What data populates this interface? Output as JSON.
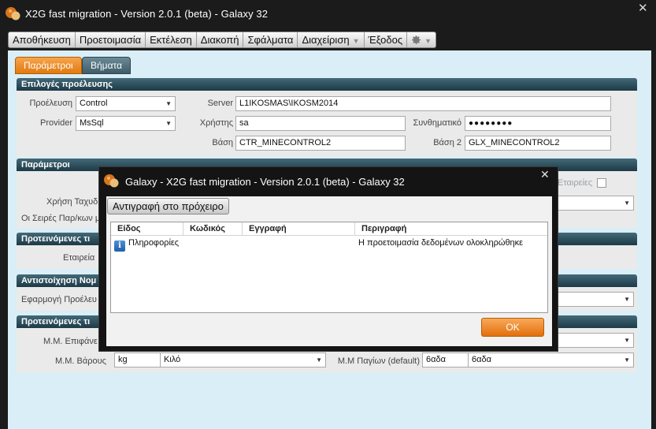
{
  "window": {
    "title": "X2G fast migration - Version 2.0.1 (beta) - Galaxy 32",
    "close_glyph": "✕"
  },
  "menu": [
    {
      "label": "Αποθήκευση",
      "has_dropdown": false
    },
    {
      "label": "Προετοιμασία",
      "has_dropdown": false
    },
    {
      "label": "Εκτέλεση",
      "has_dropdown": false
    },
    {
      "label": "Διακοπή",
      "has_dropdown": false
    },
    {
      "label": "Σφάλματα",
      "has_dropdown": false
    },
    {
      "label": "Διαχείριση",
      "has_dropdown": true
    },
    {
      "label": "Έξοδος",
      "has_dropdown": false
    },
    {
      "label": "",
      "icon": "gear-icon",
      "has_dropdown": true
    }
  ],
  "tabs": {
    "params": "Παράμετροι",
    "steps": "Βήματα",
    "active": "params"
  },
  "source": {
    "header": "Επιλογές προέλευσης",
    "source_label": "Προέλευση",
    "source_value": "Control",
    "provider_label": "Provider",
    "provider_value": "MsSql",
    "server_label": "Server",
    "server_value": "L1IKOSMAS\\IKOSM2014",
    "user_label": "Χρήστης",
    "user_value": "sa",
    "password_label": "Συνθηματικό",
    "password_value": "●●●●●●●●",
    "db_label": "Βάση",
    "db_value": "CTR_MINECONTROL2",
    "db2_label": "Βάση 2",
    "db2_value": "GLX_MINECONTROL2"
  },
  "params": {
    "header": "Παράμετροι",
    "cash_user_label": "Χρήση Ταχυδ",
    "series_label": "Οι Σειρές Παρ/κων μ",
    "companies_label": "Εταιρείες"
  },
  "suggested1": {
    "header": "Προτεινόμενες τι",
    "company_label": "Εταιρεία"
  },
  "mapping": {
    "header": "Αντιστοίχηση Νομ",
    "apply_label": "Εφαρμογή Προέλευ"
  },
  "suggested2": {
    "header": "Προτεινόμενες τι",
    "surface_label": "Μ.Μ. Επιφάνε",
    "weight_label": "Μ.Μ. Βάρους",
    "weight_code": "kg",
    "weight_value": "Κιλό",
    "fixed_label": "Μ.Μ Παγίων (default)",
    "fixed_code": "6αδα",
    "fixed_value": "6αδα"
  },
  "dialog": {
    "title": "Galaxy - X2G fast migration - Version 2.0.1 (beta) - Galaxy 32",
    "close_glyph": "✕",
    "copy_button": "Αντιγραφή στο πρόχειρο",
    "columns": [
      "Είδος",
      "Κωδικός",
      "Εγγραφή",
      "Περιγραφή"
    ],
    "rows": [
      {
        "type": "Πληροφορίες",
        "type_icon": "info-icon",
        "code": "",
        "record": "",
        "description": "Η προετοιμασία δεδομένων ολοκληρώθηκε"
      }
    ],
    "ok_button": "OK"
  },
  "colors": {
    "accent_orange": "#e07a10",
    "panel_header": "#1d3a47",
    "client_bg": "#d9eef6",
    "chrome_dark": "#1b1b1b"
  }
}
